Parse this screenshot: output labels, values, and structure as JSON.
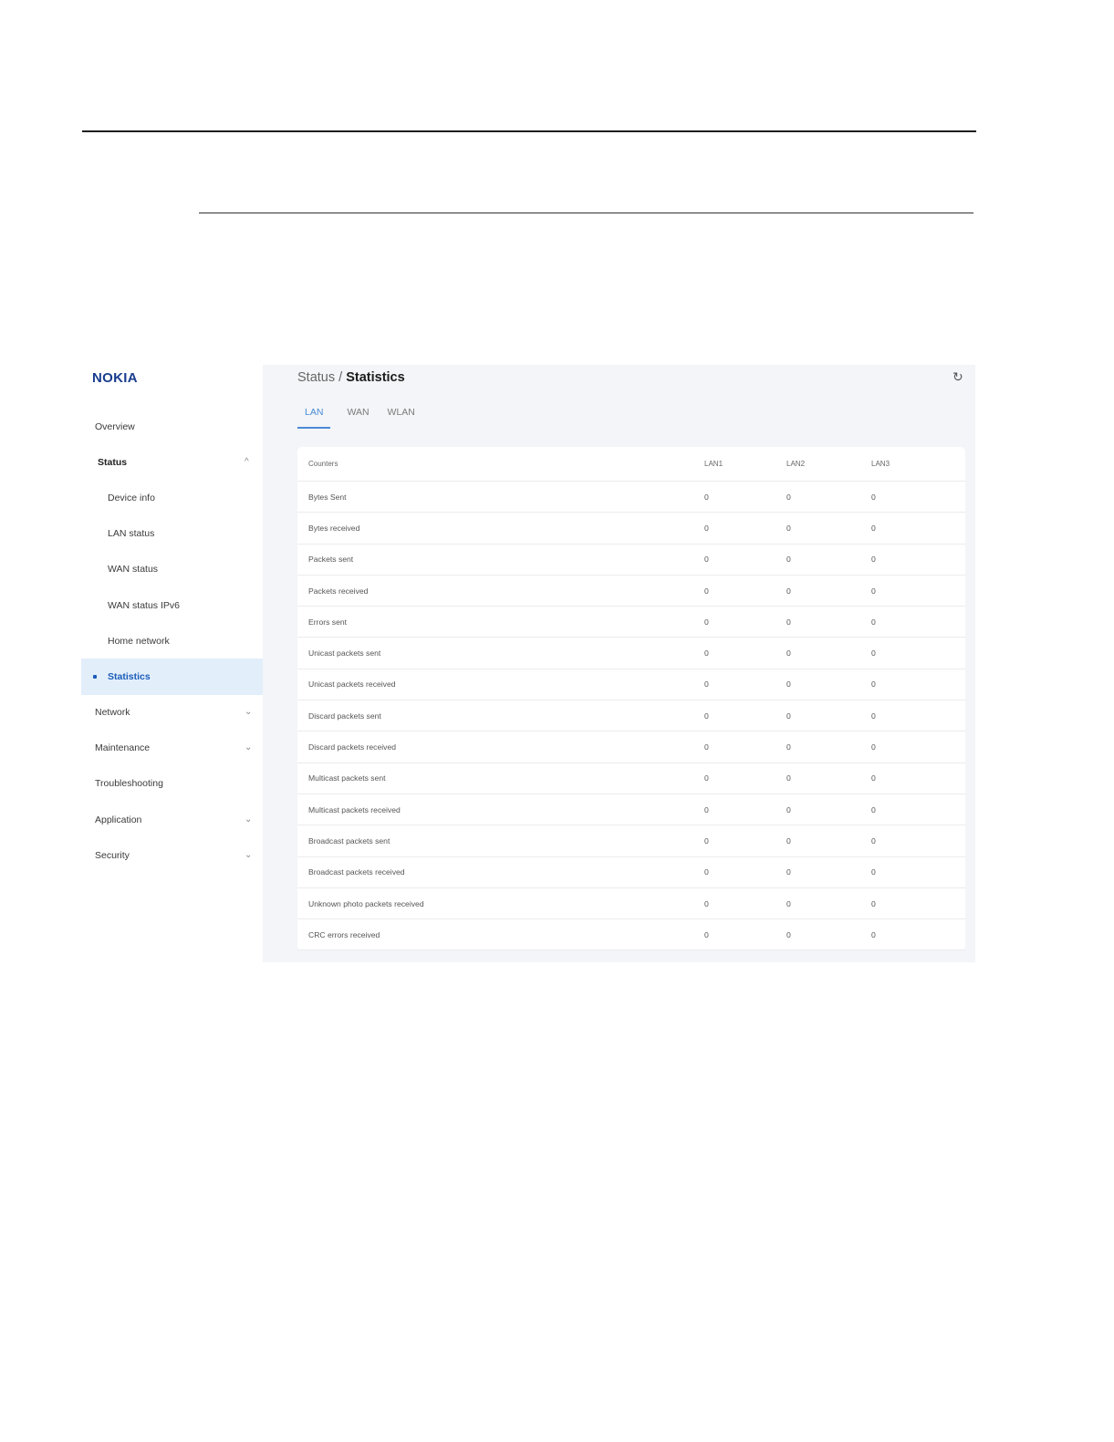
{
  "brand": {
    "logo_text": "NOKIA",
    "color": "#1a3d8f"
  },
  "sidebar": {
    "items": [
      {
        "label": "Overview"
      },
      {
        "label": "Status",
        "chevron": "^"
      },
      {
        "label": "Device info"
      },
      {
        "label": "LAN status"
      },
      {
        "label": "WAN status"
      },
      {
        "label": "WAN status IPv6"
      },
      {
        "label": "Home network"
      },
      {
        "label": "Statistics"
      },
      {
        "label": "Network",
        "chevron": "⌄"
      },
      {
        "label": "Maintenance",
        "chevron": "⌄"
      },
      {
        "label": "Troubleshooting"
      },
      {
        "label": "Application",
        "chevron": "⌄"
      },
      {
        "label": "Security",
        "chevron": "⌄"
      }
    ]
  },
  "header": {
    "breadcrumb_parent": "Status /",
    "breadcrumb_current": "Statistics",
    "refresh_icon": "↻"
  },
  "tabs": [
    {
      "label": "LAN"
    },
    {
      "label": "WAN"
    },
    {
      "label": "WLAN"
    }
  ],
  "table": {
    "columns": [
      "Counters",
      "LAN1",
      "LAN2",
      "LAN3"
    ],
    "rows": [
      [
        "Bytes Sent",
        "0",
        "0",
        "0"
      ],
      [
        "Bytes received",
        "0",
        "0",
        "0"
      ],
      [
        "Packets sent",
        "0",
        "0",
        "0"
      ],
      [
        "Packets received",
        "0",
        "0",
        "0"
      ],
      [
        "Errors sent",
        "0",
        "0",
        "0"
      ],
      [
        "Unicast packets sent",
        "0",
        "0",
        "0"
      ],
      [
        "Unicast packets received",
        "0",
        "0",
        "0"
      ],
      [
        "Discard packets sent",
        "0",
        "0",
        "0"
      ],
      [
        "Discard packets received",
        "0",
        "0",
        "0"
      ],
      [
        "Multicast packets sent",
        "0",
        "0",
        "0"
      ],
      [
        "Multicast packets received",
        "0",
        "0",
        "0"
      ],
      [
        "Broadcast packets sent",
        "0",
        "0",
        "0"
      ],
      [
        "Broadcast packets received",
        "0",
        "0",
        "0"
      ],
      [
        "Unknown photo packets received",
        "0",
        "0",
        "0"
      ],
      [
        "CRC errors received",
        "0",
        "0",
        "0"
      ]
    ]
  },
  "colors": {
    "accent": "#4a8ad6",
    "active_nav_bg": "#e3eefb",
    "main_bg": "#f3f5f8"
  }
}
